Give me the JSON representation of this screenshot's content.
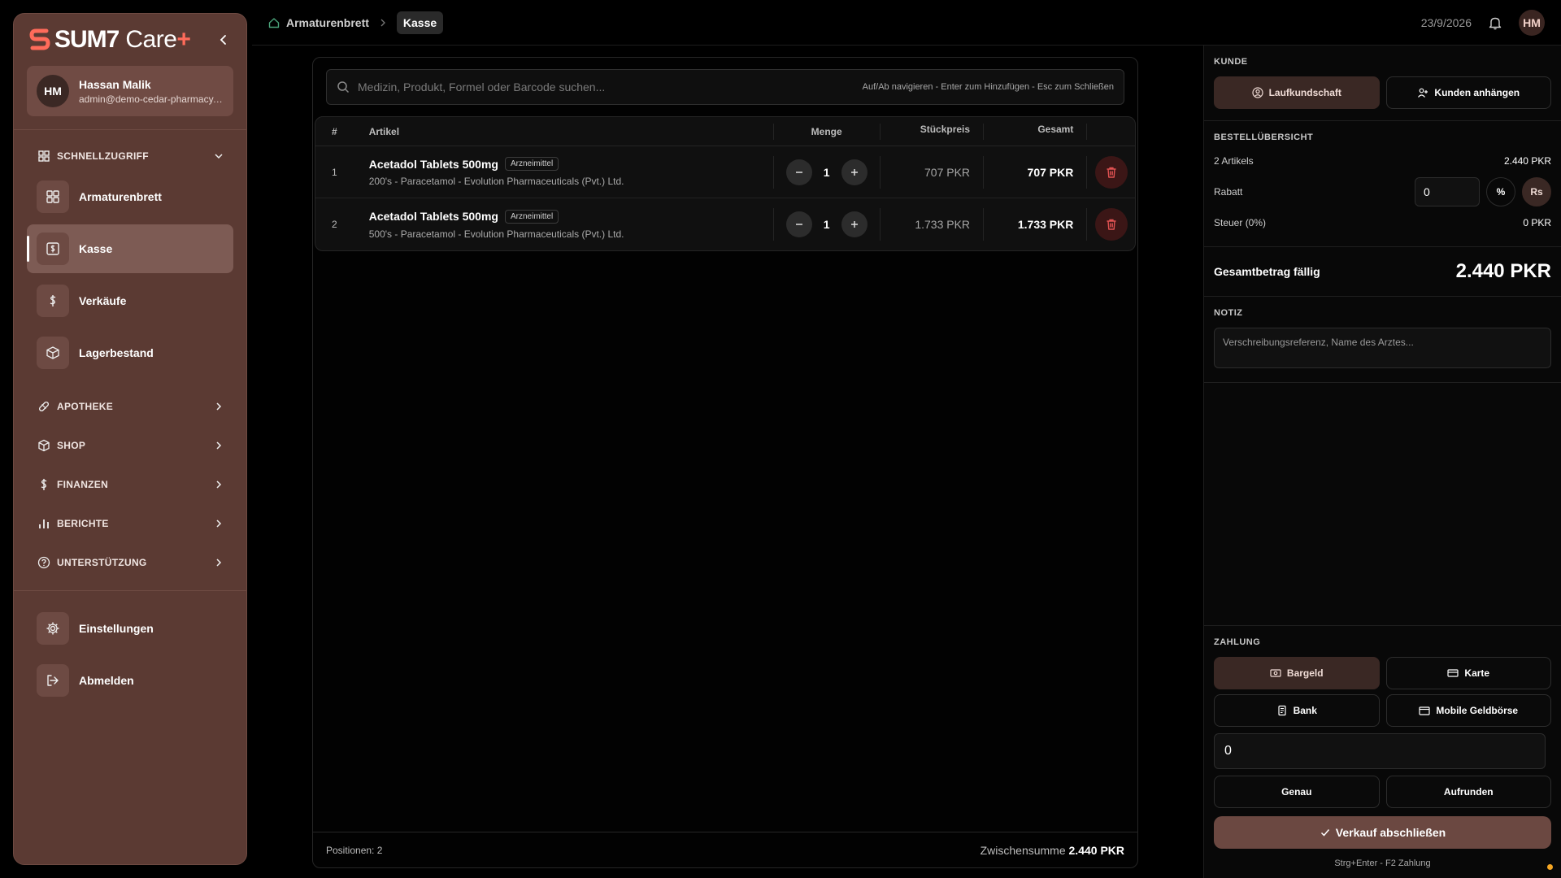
{
  "brand": {
    "name": "SUM7",
    "suffix": "Care",
    "plus": "+"
  },
  "user": {
    "initials": "HM",
    "name": "Hassan Malik",
    "email": "admin@demo-cedar-pharmacy...."
  },
  "sidebar": {
    "quick_access_label": "SCHNELLZUGRIFF",
    "items": [
      {
        "label": "Armaturenbrett",
        "icon": "dashboard-icon"
      },
      {
        "label": "Kasse",
        "icon": "cash-register-icon"
      },
      {
        "label": "Verkäufe",
        "icon": "dollar-icon"
      },
      {
        "label": "Lagerbestand",
        "icon": "box-icon"
      }
    ],
    "groups": [
      {
        "label": "APOTHEKE",
        "icon": "pill-icon"
      },
      {
        "label": "SHOP",
        "icon": "shop-icon"
      },
      {
        "label": "FINANZEN",
        "icon": "dollar-icon"
      },
      {
        "label": "BERICHTE",
        "icon": "chart-icon"
      },
      {
        "label": "UNTERSTÜTZUNG",
        "icon": "help-icon"
      }
    ],
    "bottom": [
      {
        "label": "Einstellungen",
        "icon": "gear-icon"
      },
      {
        "label": "Abmelden",
        "icon": "logout-icon"
      }
    ]
  },
  "breadcrumb": {
    "home": "Armaturenbrett",
    "current": "Kasse"
  },
  "topbar": {
    "date": "23/9/2026",
    "initials": "HM"
  },
  "search": {
    "placeholder": "Medizin, Produkt, Formel oder Barcode suchen...",
    "hint": "Auf/Ab navigieren - Enter zum Hinzufügen - Esc zum Schließen"
  },
  "table": {
    "headers": {
      "index": "#",
      "article": "Artikel",
      "qty": "Menge",
      "unit_price": "Stückpreis",
      "total": "Gesamt"
    },
    "rows": [
      {
        "index": "1",
        "name": "Acetadol Tablets 500mg",
        "badge": "Arzneimittel",
        "sub": "200's - Paracetamol - Evolution Pharmaceuticals (Pvt.) Ltd.",
        "qty": "1",
        "unit_price": "707 PKR",
        "total": "707 PKR"
      },
      {
        "index": "2",
        "name": "Acetadol Tablets 500mg",
        "badge": "Arzneimittel",
        "sub": "500's - Paracetamol - Evolution Pharmaceuticals (Pvt.) Ltd.",
        "qty": "1",
        "unit_price": "1.733 PKR",
        "total": "1.733 PKR"
      }
    ]
  },
  "cart_footer": {
    "positions": "Positionen: 2",
    "subtotal_label": "Zwischensumme",
    "subtotal_value": "2.440 PKR"
  },
  "customer": {
    "label": "KUNDE",
    "walkin": "Laufkundschaft",
    "attach": "Kunden anhängen"
  },
  "summary": {
    "label": "BESTELLÜBERSICHT",
    "items_label": "2 Artikels",
    "items_value": "2.440 PKR",
    "discount_label": "Rabatt",
    "discount_value": "0",
    "percent": "%",
    "rupee": "Rs",
    "tax_label": "Steuer (0%)",
    "tax_value": "0 PKR",
    "total_label": "Gesamtbetrag fällig",
    "total_value": "2.440 PKR"
  },
  "note": {
    "label": "NOTIZ",
    "placeholder": "Verschreibungsreferenz, Name des Arztes..."
  },
  "payment": {
    "label": "ZAHLUNG",
    "methods": [
      "Bargeld",
      "Karte",
      "Bank",
      "Mobile Geldbörse"
    ],
    "amount": "0",
    "exact": "Genau",
    "round_up": "Aufrunden",
    "complete": "Verkauf abschließen",
    "shortcut": "Strg+Enter - F2 Zahlung"
  },
  "colors": {
    "accent": "#6b4841",
    "sidebar": "#5b3a33",
    "danger": "#e05252"
  }
}
